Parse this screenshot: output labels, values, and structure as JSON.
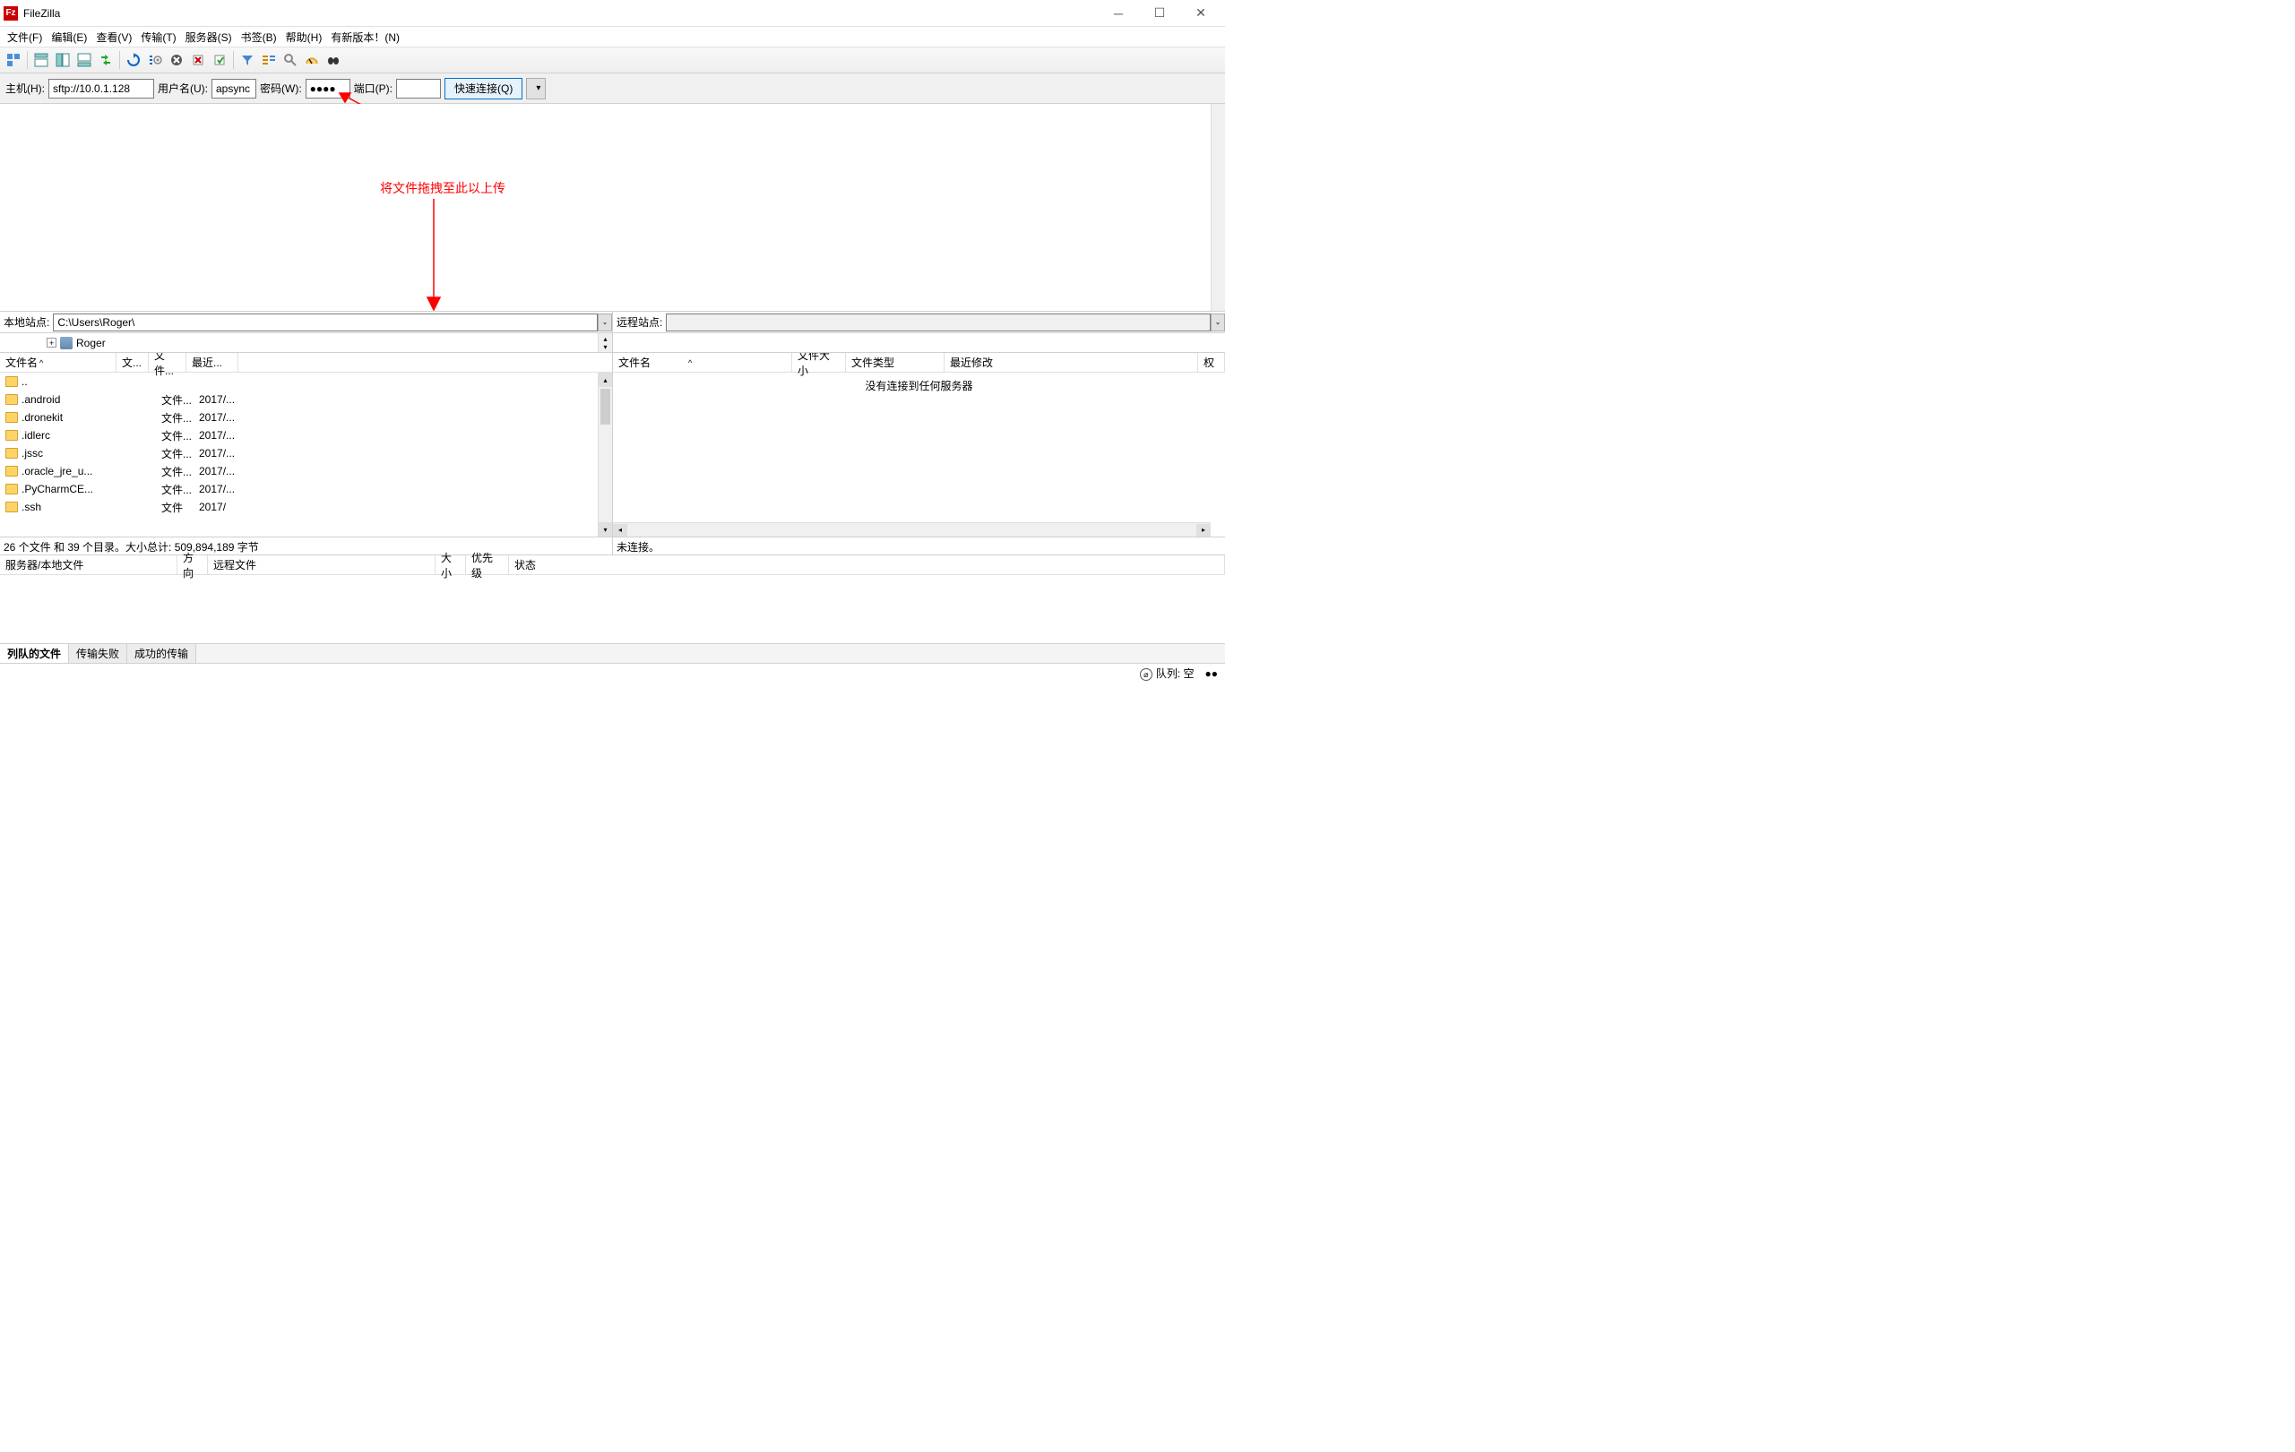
{
  "title": "FileZilla",
  "menu": [
    "文件(F)",
    "编辑(E)",
    "查看(V)",
    "传输(T)",
    "服务器(S)",
    "书签(B)",
    "帮助(H)",
    "有新版本！(N)"
  ],
  "quickconnect": {
    "host_label": "主机(H):",
    "host": "sftp://10.0.1.128",
    "user_label": "用户名(U):",
    "user": "apsync",
    "pass_label": "密码(W):",
    "pass": "●●●●",
    "port_label": "端口(P):",
    "port": "",
    "button": "快速连接(Q)"
  },
  "annotation": "将文件拖拽至此以上传",
  "local_site_label": "本地站点:",
  "local_site": "C:\\Users\\Roger\\",
  "remote_site_label": "远程站点:",
  "remote_site": "",
  "tree_user": "Roger",
  "local_cols": {
    "name": "文件名",
    "size": "文...",
    "type": "文件...",
    "date": "最近..."
  },
  "remote_cols": [
    "文件名",
    "文件大小",
    "文件类型",
    "最近修改",
    "权"
  ],
  "local_files": [
    {
      "name": "..",
      "size": "",
      "type": "",
      "date": ""
    },
    {
      "name": ".android",
      "size": "",
      "type": "文件...",
      "date": "2017/..."
    },
    {
      "name": ".dronekit",
      "size": "",
      "type": "文件...",
      "date": "2017/..."
    },
    {
      "name": ".idlerc",
      "size": "",
      "type": "文件...",
      "date": "2017/..."
    },
    {
      "name": ".jssc",
      "size": "",
      "type": "文件...",
      "date": "2017/..."
    },
    {
      "name": ".oracle_jre_u...",
      "size": "",
      "type": "文件...",
      "date": "2017/..."
    },
    {
      "name": ".PyCharmCE...",
      "size": "",
      "type": "文件...",
      "date": "2017/..."
    },
    {
      "name": ".ssh",
      "size": "",
      "type": "文件",
      "date": "2017/"
    }
  ],
  "remote_empty": "没有连接到任何服务器",
  "local_status": "26 个文件 和 39 个目录。大小总计: 509,894,189 字节",
  "remote_status": "未连接。",
  "queue_cols": [
    "服务器/本地文件",
    "方向",
    "远程文件",
    "大小",
    "优先级",
    "状态"
  ],
  "queue_tabs": [
    "列队的文件",
    "传输失败",
    "成功的传输"
  ],
  "statusbar": "队列: 空",
  "sort_indicator": "^",
  "dropdown_char": "⌄"
}
